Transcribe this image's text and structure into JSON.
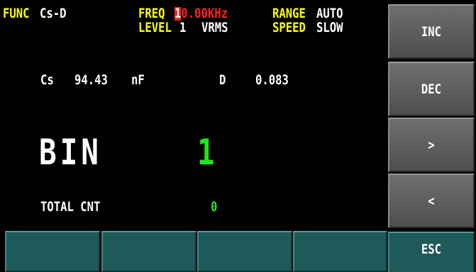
{
  "header": {
    "func_label": "FUNC",
    "func_value": "Cs-D",
    "freq_label": "FREQ",
    "freq_cursor_digit": "1",
    "freq_rest": "0.00KHz",
    "range_label": "RANGE",
    "range_value": "AUTO",
    "level_label": "LEVEL",
    "level_value": "1",
    "level_unit": "VRMS",
    "speed_label": "SPEED",
    "speed_value": "SLOW"
  },
  "measurement": {
    "primary_label": "Cs",
    "primary_value": "94.43",
    "primary_unit": "nF",
    "secondary_label": "D",
    "secondary_value": "0.083"
  },
  "bin": {
    "label": "BIN",
    "value": "1"
  },
  "total": {
    "label": "TOTAL CNT",
    "value": "0"
  },
  "side_buttons": [
    "INC",
    "DEC",
    ">",
    "<"
  ],
  "esc_label": "ESC",
  "colors": {
    "label": "#ffff00",
    "value": "#ffffff",
    "cursor": "#ff2020",
    "bin_value": "#1ee61e",
    "softkey": "#1f5a5a"
  }
}
